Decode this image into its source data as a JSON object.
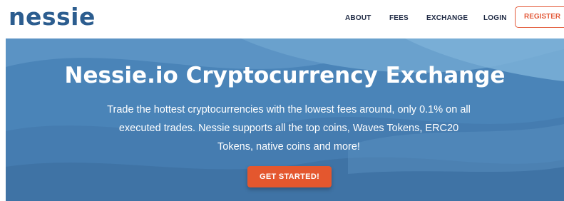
{
  "brand": {
    "logo_text": "nessie",
    "logo_color": "#2c5d8f"
  },
  "nav": {
    "items": [
      {
        "label": "ABOUT"
      },
      {
        "label": "FEES"
      },
      {
        "label": "EXCHANGE"
      },
      {
        "label": "LOGIN"
      }
    ],
    "register_label": "REGISTER",
    "register_color": "#e35a3a"
  },
  "hero": {
    "title": "Nessie.io Cryptocurrency Exchange",
    "description": "Trade the hottest cryptocurrencies with the lowest fees around, only 0.1% on all executed trades. Nessie supports all the top coins, Waves Tokens, ERC20 Tokens, native coins and more!",
    "cta_label": "GET STARTED!",
    "background_color": "#4a84b8",
    "cta_color": "#e4572e"
  }
}
